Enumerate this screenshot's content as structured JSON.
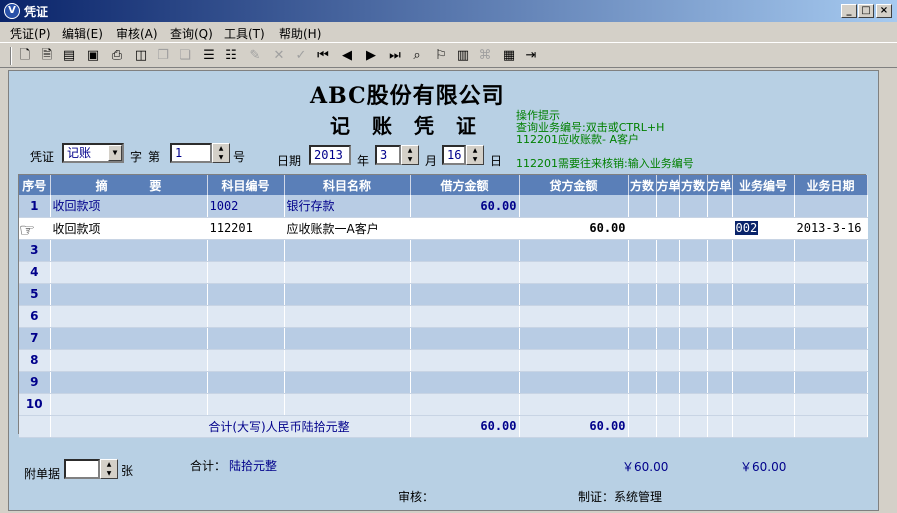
{
  "window": {
    "title": "凭证",
    "app_icon_letter": "V"
  },
  "menu": [
    "凭证(P)",
    "编辑(E)",
    "审核(A)",
    "查询(Q)",
    "工具(T)",
    "帮助(H)"
  ],
  "header": {
    "company": "ABC股份有限公司",
    "doc_title": "记账凭证",
    "hints": [
      "操作提示",
      "查询业务编号:双击或CTRL+H",
      "112201应收账款- A客户",
      "112201需要往来核销:输入业务编号"
    ]
  },
  "form": {
    "voucher_label": "凭证",
    "voucher_type": "记账",
    "zi_label": "字",
    "di_label": "第",
    "voucher_no": "1",
    "hao_label": "号",
    "date_label": "日期",
    "year": "2013",
    "year_label": "年",
    "month": "3",
    "month_label": "月",
    "day": "16",
    "day_label": "日"
  },
  "grid": {
    "columns": [
      "序号",
      "摘          要",
      "科目编号",
      "科目名称",
      "借方金额",
      "贷方金额",
      "方数",
      "方单",
      "方数",
      "方单",
      "业务编号",
      "业务日期"
    ],
    "rows": [
      {
        "seq": "1",
        "summary": "收回款项",
        "code": "1002",
        "name": "银行存款",
        "debit": "60.00",
        "credit": "",
        "biz_no": "",
        "biz_date": ""
      },
      {
        "seq": "",
        "summary": "收回款项",
        "code": "112201",
        "name": "应收账款一A客户",
        "debit": "",
        "credit": "60.00",
        "biz_no": "002",
        "biz_date": "2013-3-16"
      },
      {
        "seq": "3",
        "summary": "",
        "code": "",
        "name": "",
        "debit": "",
        "credit": "",
        "biz_no": "",
        "biz_date": ""
      },
      {
        "seq": "4",
        "summary": "",
        "code": "",
        "name": "",
        "debit": "",
        "credit": "",
        "biz_no": "",
        "biz_date": ""
      },
      {
        "seq": "5",
        "summary": "",
        "code": "",
        "name": "",
        "debit": "",
        "credit": "",
        "biz_no": "",
        "biz_date": ""
      },
      {
        "seq": "6",
        "summary": "",
        "code": "",
        "name": "",
        "debit": "",
        "credit": "",
        "biz_no": "",
        "biz_date": ""
      },
      {
        "seq": "7",
        "summary": "",
        "code": "",
        "name": "",
        "debit": "",
        "credit": "",
        "biz_no": "",
        "biz_date": ""
      },
      {
        "seq": "8",
        "summary": "",
        "code": "",
        "name": "",
        "debit": "",
        "credit": "",
        "biz_no": "",
        "biz_date": ""
      },
      {
        "seq": "9",
        "summary": "",
        "code": "",
        "name": "",
        "debit": "",
        "credit": "",
        "biz_no": "",
        "biz_date": ""
      },
      {
        "seq": "10",
        "summary": "",
        "code": "",
        "name": "",
        "debit": "",
        "credit": "",
        "biz_no": "",
        "biz_date": ""
      }
    ],
    "total": {
      "label": "合计(大写)人民币陆拾元整",
      "debit": "60.00",
      "credit": "60.00"
    }
  },
  "footer": {
    "attach_label": "附单据",
    "attach_unit": "张",
    "total_label": "合计：",
    "total_text": "陆拾元整",
    "debit_total": "￥60.00",
    "credit_total": "￥60.00",
    "audit_label": "审核：",
    "maker_label": "制证：系统管理"
  },
  "colors": {
    "header_bg": "#5a7fb8",
    "panel_bg": "#b8d0e4",
    "hint": "#008000",
    "value": "#00008b"
  }
}
